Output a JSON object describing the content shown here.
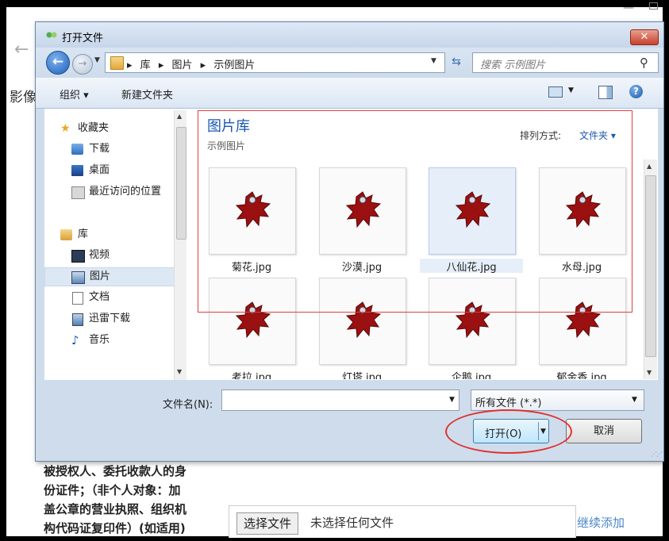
{
  "background": {
    "description_lines": [
      "被授权人、委托收款人的身",
      "份证件；（非个人对象：加",
      "盖公章的营业执照、组织机",
      "构代码证复印件）(如适用)"
    ],
    "side_label": "影像",
    "file_button": "选择文件",
    "file_none": "未选择任何文件",
    "add_link": "继续添加"
  },
  "dialog": {
    "title": "打开文件",
    "close_label": "✕",
    "address": {
      "crumbs": [
        "库",
        "图片",
        "示例图片"
      ]
    },
    "search_placeholder": "搜索 示例图片",
    "toolbar": {
      "organize": "组织 ▾",
      "new_folder": "新建文件夹"
    },
    "nav": {
      "favorites": "收藏夹",
      "downloads": "下载",
      "desktop": "桌面",
      "recent": "最近访问的位置",
      "libraries": "库",
      "videos": "视频",
      "pictures": "图片",
      "documents": "文档",
      "thunder": "迅雷下载",
      "music": "音乐"
    },
    "library_title": "图片库",
    "library_subtitle": "示例图片",
    "arrange_label": "排列方式:",
    "arrange_value": "文件夹 ▾",
    "files": [
      "菊花.jpg",
      "沙漠.jpg",
      "八仙花.jpg",
      "水母.jpg",
      "考拉.jpg",
      "灯塔.jpg",
      "企鹅.jpg",
      "郁金香.jpg"
    ],
    "selected_file_index": 2,
    "filename_label": "文件名(N):",
    "filename_value": "",
    "filter_value": "所有文件 (*.*)",
    "open_label": "打开(O)",
    "cancel_label": "取消"
  },
  "colors": {
    "accent": "#1a56b0",
    "annotation_red": "#e04040",
    "thumbnail_red": "#9b1010"
  }
}
